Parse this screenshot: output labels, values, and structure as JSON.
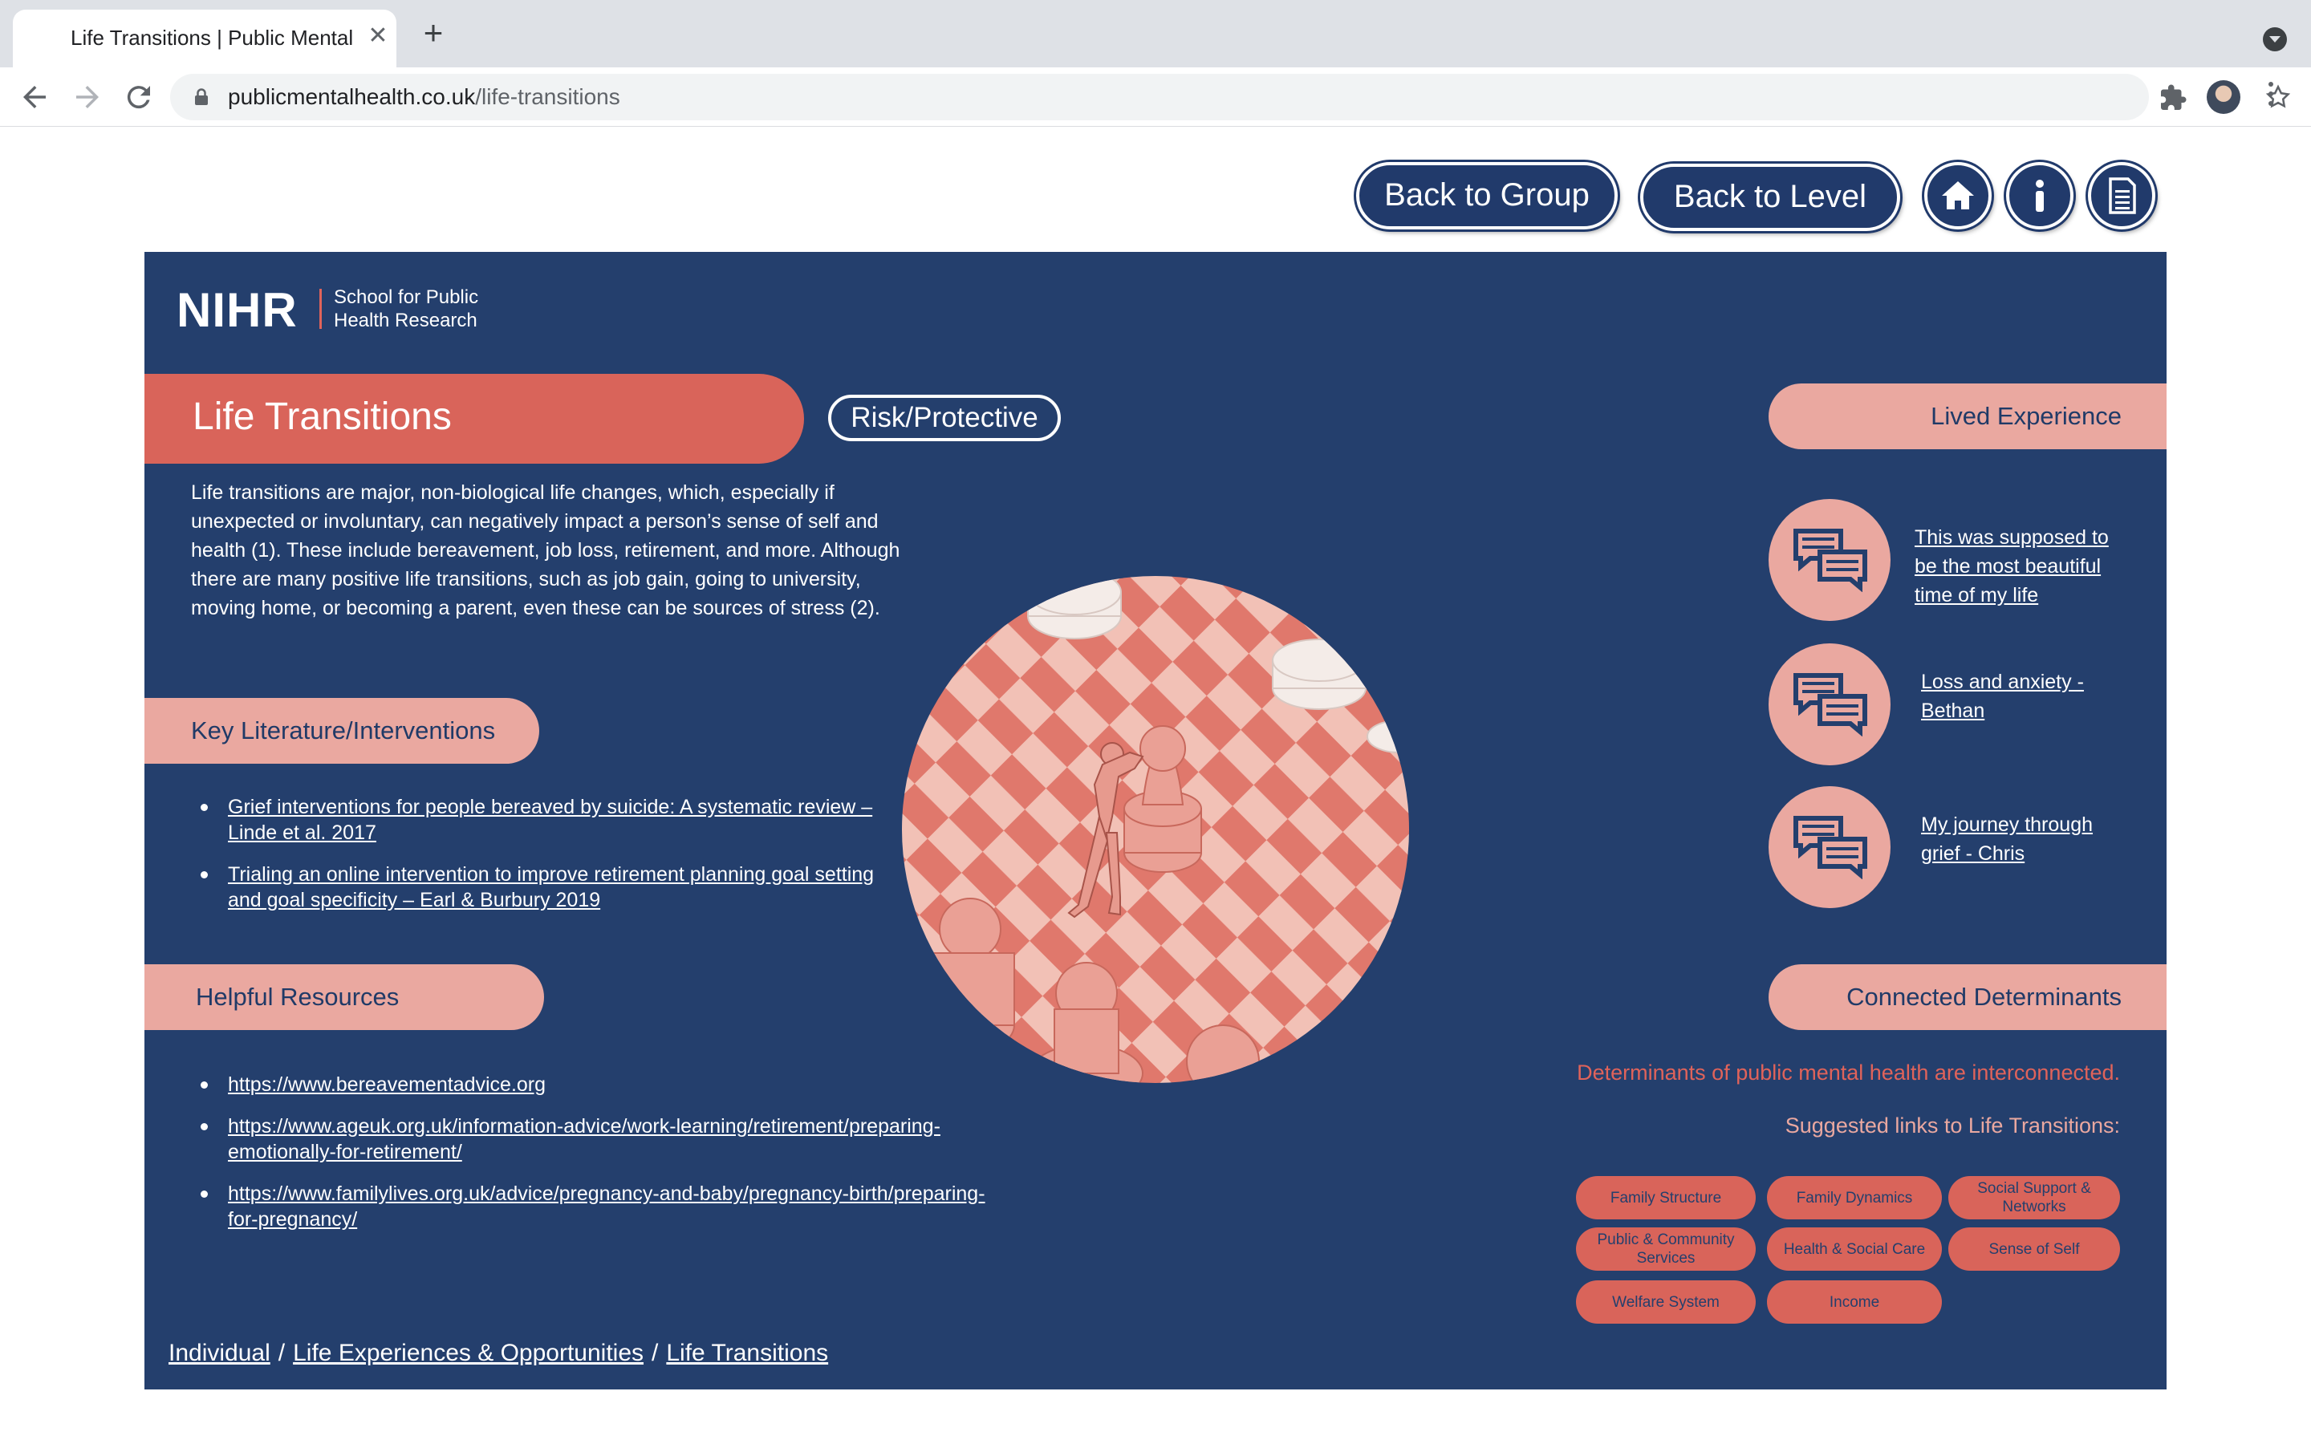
{
  "browser": {
    "tab_title": "Life Transitions | Public Mental",
    "tab_close": "✕",
    "new_tab": "+",
    "url_host": "publicmentalhealth.co.uk",
    "url_path": "/life-transitions"
  },
  "top_nav": {
    "back_to_group": "Back to Group",
    "back_to_level": "Back to Level"
  },
  "logo": {
    "name": "NIHR",
    "subtitle_line1": "School for Public",
    "subtitle_line2": "Health Research"
  },
  "page": {
    "title": "Life Transitions",
    "risk_label": "Risk/Protective",
    "intro": "Life transitions are major, non-biological life changes, which, especially if unexpected or involuntary, can negatively impact a person’s sense of self and health (1). These include bereavement, job loss, retirement, and more. Although there are many positive life transitions, such as job gain, going to university, moving home, or becoming a parent, even these can be sources of stress (2)."
  },
  "literature": {
    "heading": "Key Literature/Interventions",
    "items": [
      "Grief interventions for people bereaved by suicide: A systematic review – Linde et al. 2017",
      "Trialing an online intervention to improve retirement planning goal setting and goal specificity – Earl & Burbury 2019"
    ]
  },
  "resources": {
    "heading": "Helpful Resources",
    "items": [
      "https://www.bereavementadvice.org",
      "https://www.ageuk.org.uk/information-advice/work-learning/retirement/preparing-emotionally-for-retirement/",
      "https://www.familylives.org.uk/advice/pregnancy-and-baby/pregnancy-birth/preparing-for-pregnancy/"
    ]
  },
  "lived_experience": {
    "heading": "Lived Experience",
    "stories": [
      "This was supposed to be the most beautiful time of my life",
      "Loss and anxiety - Bethan",
      "My journey through grief - Chris"
    ]
  },
  "determinants": {
    "heading": "Connected Determinants",
    "note": "Determinants of public mental health are interconnected.",
    "suggested": "Suggested links to Life Transitions:",
    "chips": [
      "Family Structure",
      "Family Dynamics",
      "Social Support & Networks",
      "Public & Community Services",
      "Health & Social Care",
      "Sense of Self",
      "Welfare System",
      "Income"
    ]
  },
  "breadcrumb": {
    "level1": "Individual",
    "level2": "Life Experiences & Opportunities",
    "level3": "Life Transitions",
    "separator": "/"
  },
  "colors": {
    "panel": "#243f6d",
    "accent_red": "#d9645a",
    "accent_pink": "#eaa8a0",
    "button_navy": "#213a6b"
  },
  "icons": [
    "back-arrow-icon",
    "forward-arrow-icon",
    "reload-icon",
    "lock-icon",
    "star-icon",
    "extensions-icon",
    "home-icon",
    "info-icon",
    "document-icon",
    "chat-bubbles-icon"
  ]
}
